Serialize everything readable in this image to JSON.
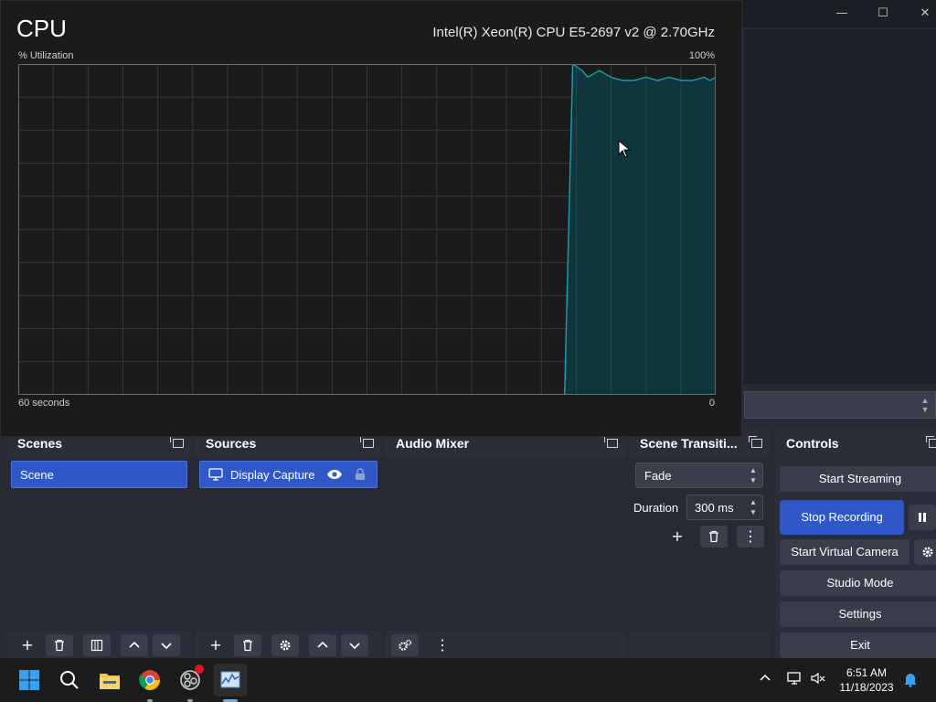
{
  "task_manager": {
    "title": "CPU",
    "cpu_model": "Intel(R) Xeon(R) CPU E5-2697 v2 @ 2.70GHz",
    "y_label": "% Utilization",
    "y_max_label": "100%",
    "x_start_label": "60 seconds",
    "x_end_label": "0",
    "graph_color": "#17a0b4",
    "graph_fill": "#0f3a42"
  },
  "chart_data": {
    "type": "area",
    "title": "CPU",
    "xlabel": "",
    "ylabel": "% Utilization",
    "xlim": [
      60,
      0
    ],
    "ylim": [
      0,
      100
    ],
    "grid": true,
    "x": [
      60,
      13,
      12.3,
      11.5,
      11,
      10,
      9,
      8,
      7,
      6,
      5,
      4,
      3,
      2,
      1,
      0.5,
      0
    ],
    "series": [
      {
        "values": [
          0,
          0,
          100,
          98,
          96,
          98,
          96,
          95,
          95,
          96,
          95,
          96,
          95,
          95,
          96,
          95,
          96
        ]
      }
    ]
  },
  "obs": {
    "docks": {
      "scenes": {
        "title": "Scenes",
        "items": [
          "Scene"
        ]
      },
      "sources": {
        "title": "Sources",
        "items": [
          {
            "label": "Display Capture"
          }
        ]
      },
      "audio_mixer": {
        "title": "Audio Mixer"
      },
      "scene_transitions": {
        "title": "Scene Transiti...",
        "transition": "Fade",
        "duration_label": "Duration",
        "duration_value": "300 ms"
      },
      "controls": {
        "title": "Controls",
        "start_streaming": "Start Streaming",
        "stop_recording": "Stop Recording",
        "start_virtual_camera": "Start Virtual Camera",
        "studio_mode": "Studio Mode",
        "settings": "Settings",
        "exit": "Exit"
      }
    }
  },
  "taskbar": {
    "time": "6:51 AM",
    "date": "11/18/2023"
  }
}
